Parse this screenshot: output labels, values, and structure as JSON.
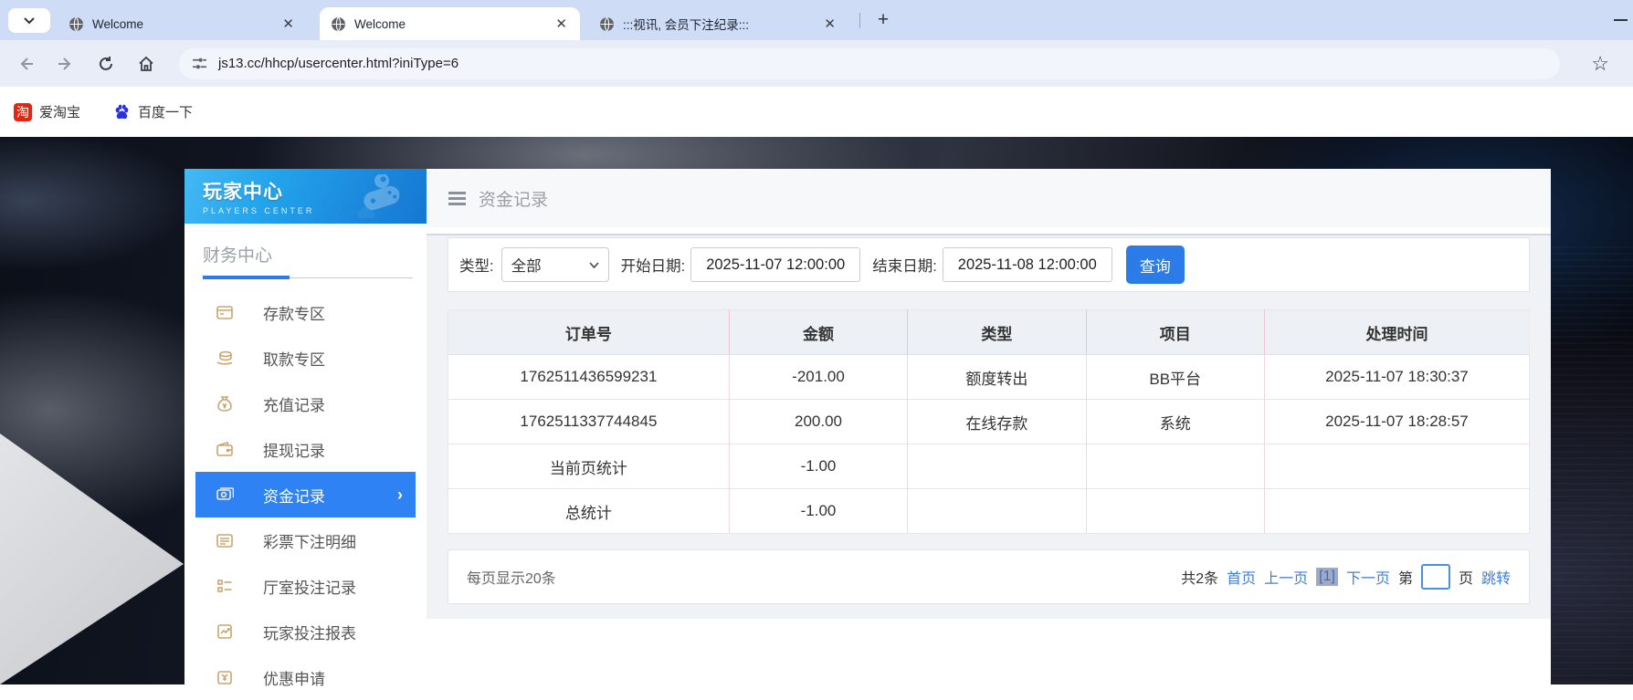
{
  "browser": {
    "tabs": [
      {
        "title": "Welcome"
      },
      {
        "title": "Welcome"
      },
      {
        "title": ":::视讯, 会员下注纪录:::"
      }
    ],
    "new_tab": "+",
    "url": "js13.cc/hhcp/usercenter.html?iniType=6",
    "bookmarks": [
      {
        "label": "爱淘宝",
        "icon_text": "淘"
      },
      {
        "label": "百度一下"
      }
    ]
  },
  "sidebar": {
    "title": "玩家中心",
    "subtitle": "PLAYERS CENTER",
    "section": "财务中心",
    "items": [
      {
        "label": "存款专区"
      },
      {
        "label": "取款专区"
      },
      {
        "label": "充值记录"
      },
      {
        "label": "提现记录"
      },
      {
        "label": "资金记录",
        "active": true,
        "chevron": "›"
      },
      {
        "label": "彩票下注明细"
      },
      {
        "label": "厅室投注记录"
      },
      {
        "label": "玩家投注报表"
      },
      {
        "label": "优惠申请"
      }
    ]
  },
  "main": {
    "header_title": "资金记录",
    "filters": {
      "type_label": "类型:",
      "type_value": "全部",
      "start_label": "开始日期:",
      "start_value": "2025-11-07 12:00:00",
      "end_label": "结束日期:",
      "end_value": "2025-11-08 12:00:00",
      "search_button": "查询"
    },
    "table": {
      "columns": [
        "订单号",
        "金额",
        "类型",
        "项目",
        "处理时间"
      ],
      "rows": [
        [
          "1762511436599231",
          "-201.00",
          "额度转出",
          "BB平台",
          "2025-11-07 18:30:37"
        ],
        [
          "1762511337744845",
          "200.00",
          "在线存款",
          "系统",
          "2025-11-07 18:28:57"
        ],
        [
          "当前页统计",
          "-1.00",
          "",
          "",
          ""
        ],
        [
          "总统计",
          "-1.00",
          "",
          "",
          ""
        ]
      ]
    },
    "pagination": {
      "per_page": "每页显示20条",
      "total": "共2条",
      "first": "首页",
      "prev": "上一页",
      "current": "[1]",
      "next": "下一页",
      "jump_pre": "第",
      "jump_post": "页",
      "jump_button": "跳转"
    }
  },
  "colors": {
    "accent_blue": "#2e82f4",
    "button_blue": "#2b7ce9",
    "link_blue": "#3e7fdb",
    "gold_icon": "#c9a671",
    "tabstrip": "#cfdcf6",
    "sidebar_header_gradient": [
      "#45b9f4",
      "#1578d2"
    ]
  }
}
